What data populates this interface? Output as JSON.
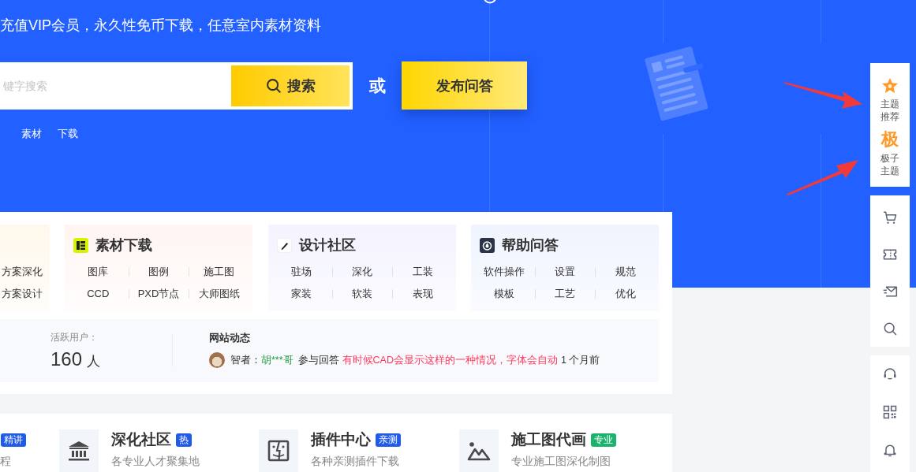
{
  "banner": {
    "slogan": "充值VIP会员，永久性免币下载，任意室内素材资料",
    "search": {
      "placeholder": "键字搜索",
      "button": "搜索"
    },
    "or_label": "或",
    "ask_button": "发布问答",
    "hot_keywords": [
      "素材",
      "下载"
    ]
  },
  "categories": [
    {
      "links": [
        [
          "方案深化"
        ],
        [
          "方案设计"
        ]
      ]
    },
    {
      "title": "素材下载",
      "links": [
        [
          "图库",
          "图例",
          "施工图"
        ],
        [
          "CCD",
          "PXD节点",
          "大师图纸"
        ]
      ]
    },
    {
      "title": "设计社区",
      "links": [
        [
          "驻场",
          "深化",
          "工装"
        ],
        [
          "家装",
          "软装",
          "表现"
        ]
      ]
    },
    {
      "title": "帮助问答",
      "links": [
        [
          "软件操作",
          "设置",
          "规范"
        ],
        [
          "模板",
          "工艺",
          "优化"
        ]
      ]
    }
  ],
  "stats": {
    "label": "活跃用户：",
    "count": "160",
    "unit": "人"
  },
  "activity": {
    "title": "网站动态",
    "role": "智者：",
    "user": "胡***哥",
    "action": "参与回答",
    "question": "有时候CAD会显示这样的一种情况，字体会自动",
    "time": "1 个月前"
  },
  "features": [
    {
      "badge": "精讲",
      "color": "#1f5ae8",
      "desc": "程"
    },
    {
      "title": "深化社区",
      "badge": "热",
      "color": "#1f5ae8",
      "desc": "各专业人才聚集地"
    },
    {
      "title": "插件中心",
      "badge": "亲测",
      "color": "#1f5ae8",
      "desc": "各种亲测插件下载"
    },
    {
      "title": "施工图代画",
      "badge": "专业",
      "color": "#19b36b",
      "desc": "专业施工图深化制图"
    }
  ],
  "sidebar": {
    "featured": [
      {
        "label": "主题推荐"
      },
      {
        "label": "极子主题",
        "glyph": "极"
      }
    ],
    "tool_groups": [
      [
        {
          "kind": "cart"
        },
        {
          "kind": "coupon"
        },
        {
          "kind": "message"
        },
        {
          "kind": "search"
        }
      ],
      [
        {
          "kind": "support"
        },
        {
          "kind": "qrcode"
        },
        {
          "kind": "notice"
        }
      ]
    ]
  }
}
